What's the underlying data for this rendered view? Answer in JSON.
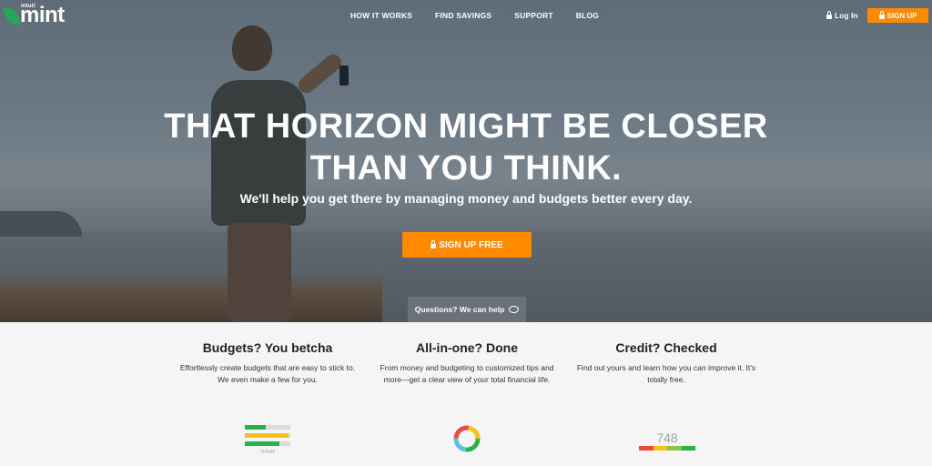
{
  "brand": {
    "small": "intuit",
    "name": "mint"
  },
  "nav": {
    "items": [
      "HOW IT WORKS",
      "FIND SAVINGS",
      "SUPPORT",
      "BLOG"
    ],
    "login": "Log In",
    "signup": "SIGN UP"
  },
  "hero": {
    "headline_1": "THAT HORIZON MIGHT BE CLOSER",
    "headline_2": "THAN YOU THINK.",
    "subline": "We'll help you get there by managing money and budgets better every day.",
    "cta": "SIGN UP FREE",
    "questions": "Questions? We can help"
  },
  "features": [
    {
      "title": "Budgets? You betcha",
      "text": "Effortlessly create budgets that are easy to stick to. We even make a few for you."
    },
    {
      "title": "All-in-one? Done",
      "text": "From money and budgeting to customized tips and more—get a clear view of your total financial life."
    },
    {
      "title": "Credit? Checked",
      "text": "Find out yours and learn how you can improve it. It's totally free."
    }
  ],
  "budget_widget": {
    "label": "TODAY",
    "bars": [
      {
        "fill": 0.45,
        "color": "#2bb24c"
      },
      {
        "fill": 0.95,
        "color": "#f5c21b"
      },
      {
        "fill": 0.75,
        "color": "#2bb24c"
      }
    ]
  },
  "credit_widget": {
    "score": "748"
  },
  "colors": {
    "accent": "#ff8a00",
    "brand_green": "#26a65b"
  }
}
